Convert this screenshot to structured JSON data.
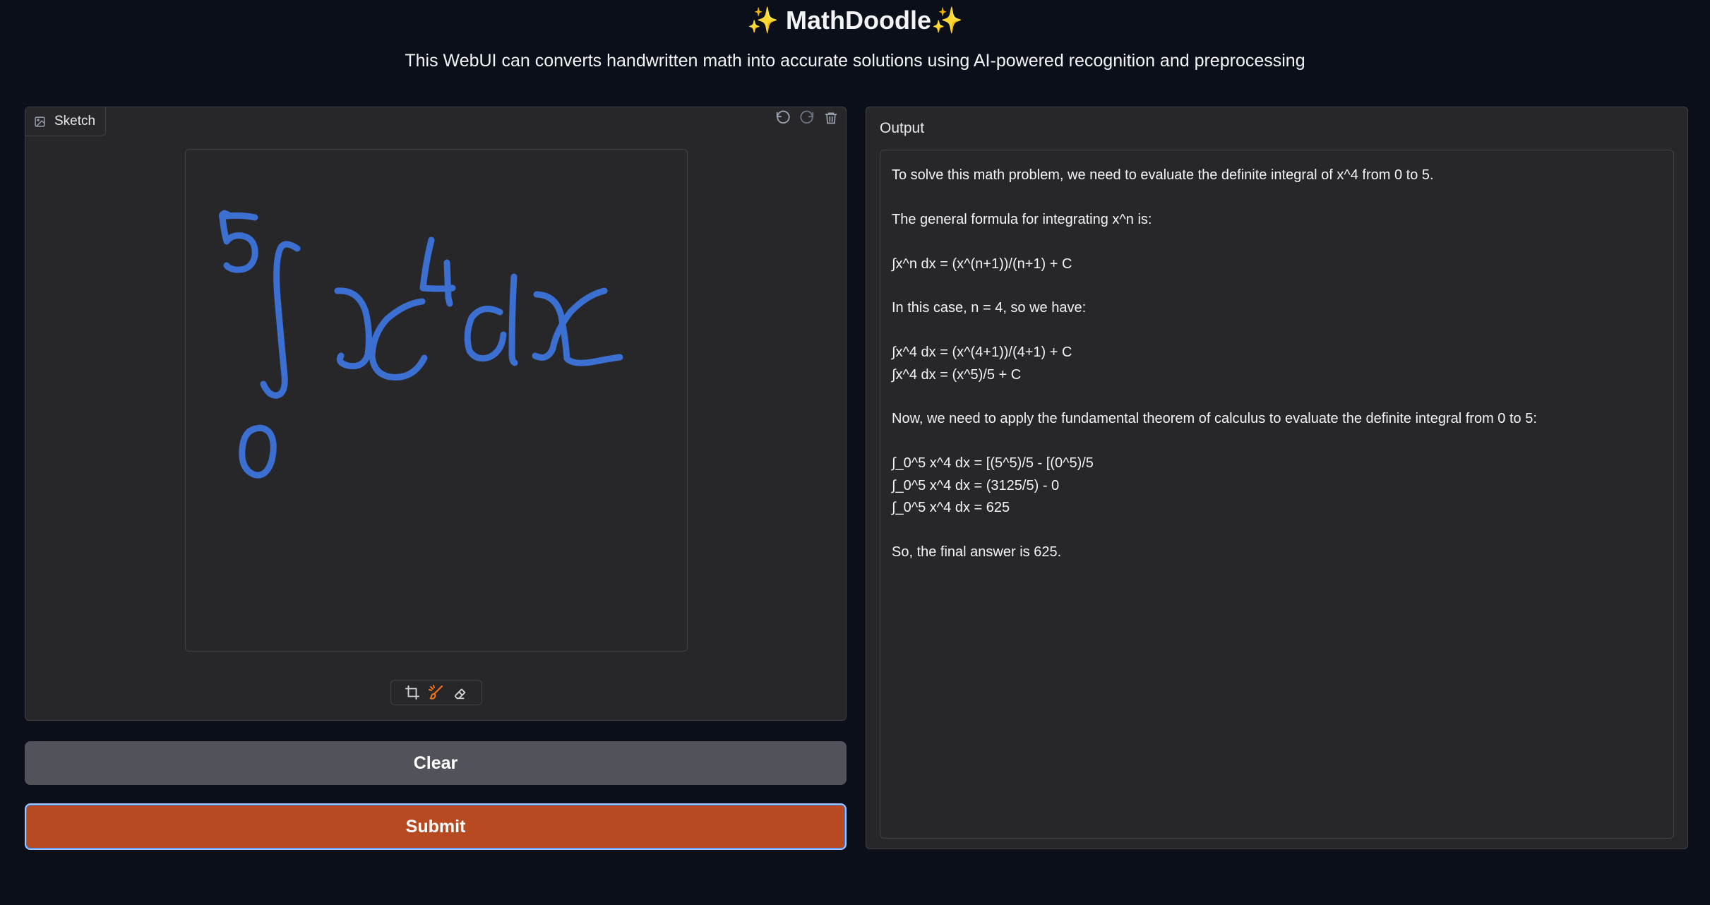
{
  "header": {
    "title": "✨ MathDoodle✨",
    "subtitle": "This WebUI can converts handwritten math into accurate solutions using AI-powered recognition and preprocessing"
  },
  "sketch": {
    "tab_label": "Sketch",
    "tab_icon": "image-icon",
    "top_tools": [
      "undo-icon",
      "redo-icon",
      "trash-icon"
    ],
    "bottom_tools": [
      "crop-icon",
      "brush-icon",
      "eraser-icon"
    ],
    "stroke_color": "#3b6fd1",
    "active_tool_color": "#f97316"
  },
  "buttons": {
    "clear_label": "Clear",
    "submit_label": "Submit"
  },
  "output": {
    "label": "Output",
    "lines": [
      "To solve this math problem, we need to evaluate the definite integral of x^4 from 0 to 5.",
      "",
      "The general formula for integrating x^n is:",
      "",
      "∫x^n dx = (x^(n+1))/(n+1) + C",
      "",
      "In this case, n = 4, so we have:",
      "",
      "∫x^4 dx = (x^(4+1))/(4+1) + C",
      "∫x^4 dx = (x^5)/5 + C",
      "",
      "Now, we need to apply the fundamental theorem of calculus to evaluate the definite integral from 0 to 5:",
      "",
      "∫_0^5 x^4 dx = [(5^5)/5 - [(0^5)/5",
      "∫_0^5 x^4 dx = (3125/5) - 0",
      "∫_0^5 x^4 dx = 625",
      "",
      "So, the final answer is 625."
    ]
  },
  "colors": {
    "background": "#0b0f19",
    "panel": "#27272a",
    "submit": "#b84a21",
    "clear": "#52525b"
  }
}
